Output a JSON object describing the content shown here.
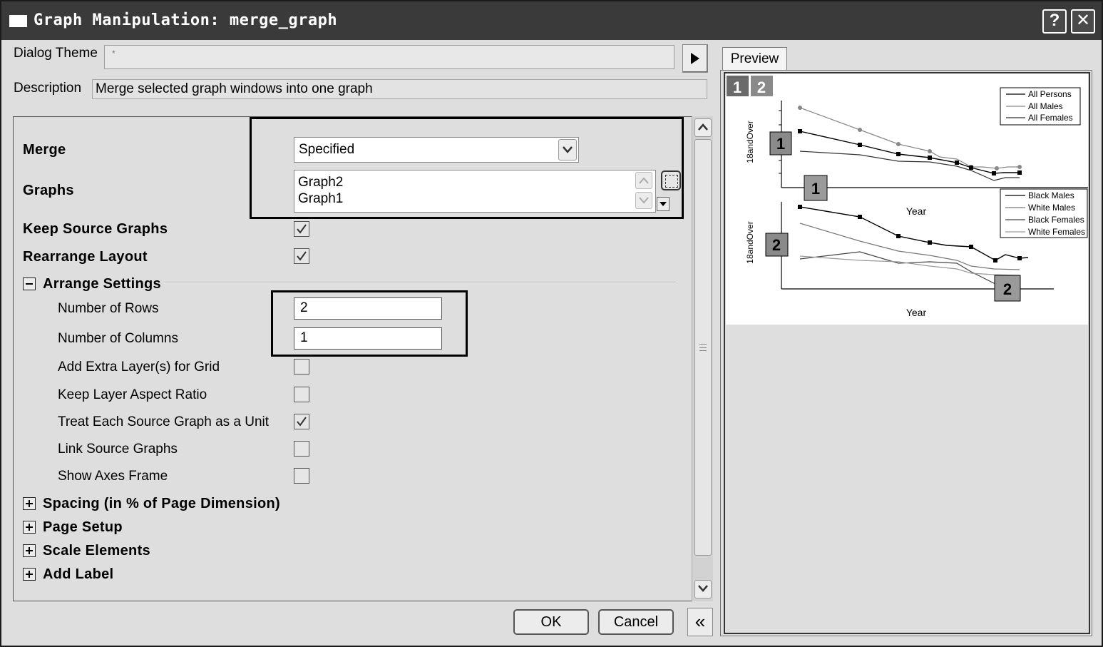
{
  "window": {
    "title": "Graph Manipulation: merge_graph",
    "help_label": "?",
    "close_label": "✕"
  },
  "dialog_theme": {
    "label": "Dialog Theme",
    "value": "*"
  },
  "description": {
    "label": "Description",
    "value": "Merge selected graph windows into one graph"
  },
  "settings": {
    "merge": {
      "label": "Merge",
      "value": "Specified"
    },
    "graphs": {
      "label": "Graphs",
      "items": [
        "Graph2",
        "Graph1"
      ]
    },
    "keep_source_graphs": {
      "label": "Keep Source Graphs",
      "checked": true
    },
    "rearrange_layout": {
      "label": "Rearrange Layout",
      "checked": true
    },
    "arrange_settings": {
      "label": "Arrange Settings",
      "rows": {
        "label": "Number of Rows",
        "value": "2"
      },
      "columns": {
        "label": "Number of Columns",
        "value": "1"
      },
      "extra_layers": {
        "label": "Add Extra Layer(s) for Grid",
        "checked": false
      },
      "aspect_ratio": {
        "label": "Keep Layer Aspect Ratio",
        "checked": false
      },
      "treat_as_unit": {
        "label": "Treat Each Source Graph as a Unit",
        "checked": true
      },
      "link_source": {
        "label": "Link Source Graphs",
        "checked": false
      },
      "axes_frame": {
        "label": "Show Axes Frame",
        "checked": false
      }
    },
    "spacing": {
      "label": "Spacing (in % of Page Dimension)"
    },
    "page_setup": {
      "label": "Page Setup"
    },
    "scale_elements": {
      "label": "Scale Elements"
    },
    "add_label": {
      "label": "Add Label"
    }
  },
  "buttons": {
    "ok": "OK",
    "cancel": "Cancel",
    "collapse": "«"
  },
  "preview": {
    "tab_label": "Preview",
    "layer_tabs": [
      "1",
      "2"
    ],
    "graph1": {
      "badge": "1",
      "ylabel": "18andOver",
      "xlabel": "Year",
      "legend": [
        "All Persons",
        "All Males",
        "All Females"
      ]
    },
    "graph2": {
      "badge": "2",
      "ylabel": "18andOver",
      "xlabel": "Year",
      "legend": [
        "Black Males",
        "White Males",
        "Black Females",
        "White Females"
      ]
    }
  }
}
